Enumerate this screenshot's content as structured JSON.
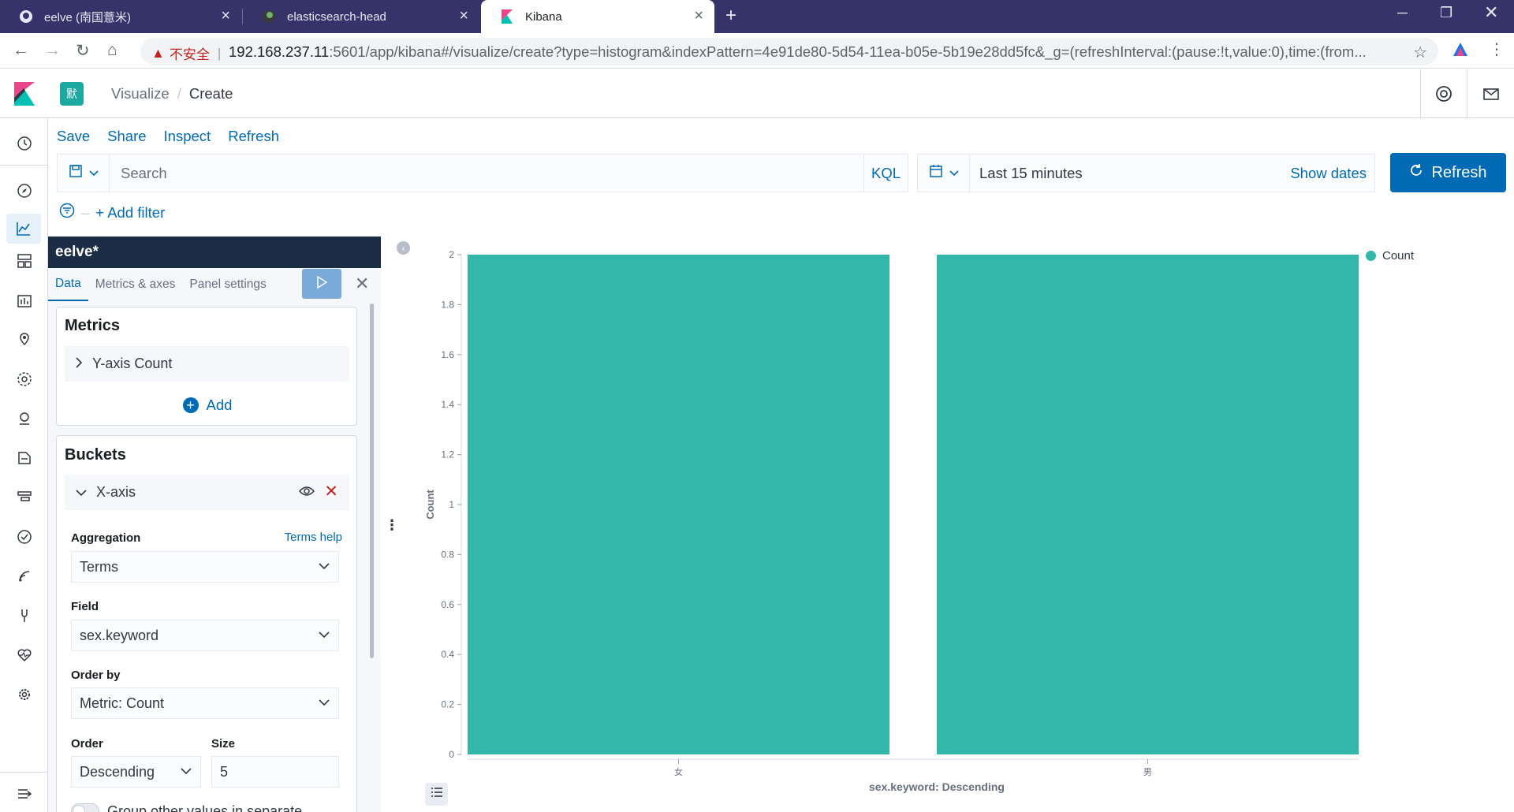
{
  "browser": {
    "tabs": [
      {
        "title": "eelve (南国薏米)",
        "icon": "github-icon"
      },
      {
        "title": "elasticsearch-head",
        "icon": "elasticsearch-icon"
      },
      {
        "title": "Kibana",
        "icon": "kibana-icon"
      }
    ],
    "security_label": "不安全",
    "url_host": "192.168.237.11",
    "url_rest": ":5601/app/kibana#/visualize/create?type=histogram&indexPattern=4e91de80-5d54-11ea-b05e-5b19e28dd5fc&_g=(refreshInterval:(pause:!t,value:0),time:(from..."
  },
  "header": {
    "space_badge": "默",
    "breadcrumbs": [
      "Visualize",
      "Create"
    ]
  },
  "topmenu": [
    "Save",
    "Share",
    "Inspect",
    "Refresh"
  ],
  "querybar": {
    "placeholder": "Search",
    "language": "KQL",
    "date_range": "Last 15 minutes",
    "show_dates": "Show dates",
    "refresh_label": "Refresh",
    "add_filter": "+ Add filter"
  },
  "editor": {
    "index_pattern": "eelve*",
    "tabs": [
      "Data",
      "Metrics & axes",
      "Panel settings"
    ],
    "metrics": {
      "title": "Metrics",
      "item": "Y-axis Count",
      "add_label": "Add"
    },
    "buckets": {
      "title": "Buckets",
      "item": "X-axis",
      "aggregation_label": "Aggregation",
      "aggregation_help": "Terms help",
      "aggregation_value": "Terms",
      "field_label": "Field",
      "field_value": "sex.keyword",
      "orderby_label": "Order by",
      "orderby_value": "Metric: Count",
      "order_label": "Order",
      "order_value": "Descending",
      "size_label": "Size",
      "size_value": "5",
      "group_other": "Group other values in separate"
    }
  },
  "colors": {
    "accent": "#006bb4",
    "bar": "#34b7ab",
    "index_header": "#1a2d44"
  },
  "chart_data": {
    "type": "bar",
    "categories": [
      "女",
      "男"
    ],
    "series": [
      {
        "name": "Count",
        "values": [
          2,
          2
        ]
      }
    ],
    "xlabel": "sex.keyword: Descending",
    "ylabel": "Count",
    "ylim": [
      0,
      2
    ],
    "yticks": [
      "0",
      "0.2",
      "0.4",
      "0.6",
      "0.8",
      "1",
      "1.2",
      "1.4",
      "1.6",
      "1.8",
      "2"
    ],
    "grid": false,
    "legend": "top-right"
  }
}
